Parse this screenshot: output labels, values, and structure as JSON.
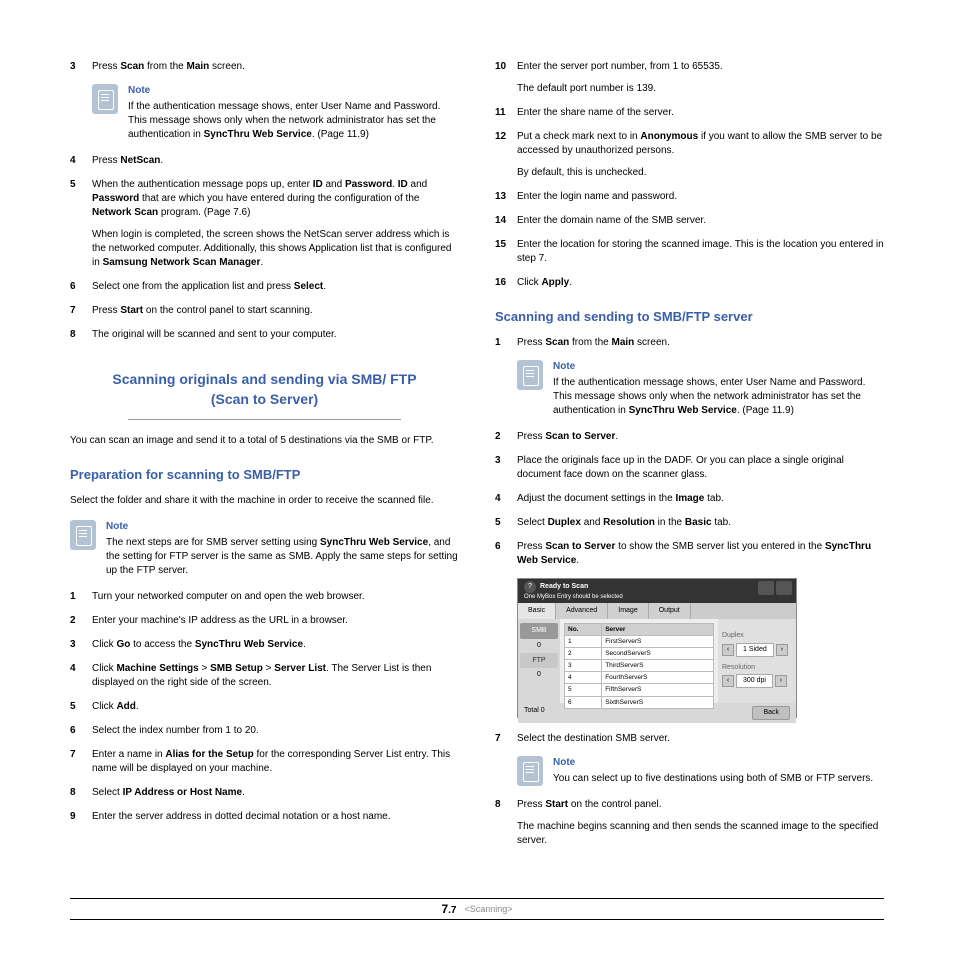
{
  "left": {
    "s3": {
      "pre": "Press ",
      "b1": "Scan",
      "mid": " from the ",
      "b2": "Main",
      "post": " screen."
    },
    "note1": {
      "title": "Note",
      "l1_pre": " If the authentication message shows, enter User Name and Password. This message shows only when the network administrator has set the authentication in ",
      "l1_b": "SyncThru Web Service",
      "l1_post": ". (Page 11.9)"
    },
    "s4": {
      "pre": "Press ",
      "b": "NetScan",
      "post": "."
    },
    "s5": {
      "p1_a": "When the authentication message pops up, enter ",
      "p1_b1": "ID",
      "p1_b": " and ",
      "p1_b2": "Password",
      "p1_c": ". ",
      "p1_b3": "ID",
      "p1_d": " and ",
      "p1_b4": "Password",
      "p1_e": " that are which you have entered during the configuration of the ",
      "p1_b5": "Network Scan",
      "p1_f": " program. (Page 7.6)",
      "p2_a": "When login is completed, the screen shows the NetScan server address which is the networked computer. Additionally, this shows Application list that is configured in ",
      "p2_b": "Samsung Network Scan Manager",
      "p2_c": "."
    },
    "s6": {
      "pre": "Select one from the application list and press ",
      "b": "Select",
      "post": "."
    },
    "s7": {
      "pre": "Press ",
      "b": "Start",
      "post": " on the control panel to start scanning."
    },
    "s8": "The original will be scanned and sent to your computer.",
    "h1_l1": "Scanning originals and sending via SMB/ FTP",
    "h1_l2": "(Scan to Server)",
    "intro1": "You can scan an image and send it to a total of 5 destinations via the SMB or FTP.",
    "h2": "Preparation for scanning to SMB/FTP",
    "intro2": "Select the folder and share it with the machine in order to receive the scanned file.",
    "note2": {
      "title": "Note",
      "a": "The next steps are for SMB server setting using ",
      "b": "SyncThru Web Service",
      "c": ", and the setting for FTP server is the same as SMB. Apply the same steps for setting up the FTP server."
    },
    "p1": "Turn your networked computer on and open the web browser.",
    "p2": "Enter your machine's IP address as the URL in a browser.",
    "p3": {
      "a": "Click ",
      "b1": "Go",
      "c": " to access the ",
      "b2": "SyncThru Web Service",
      "d": "."
    },
    "p4": {
      "a": "Click ",
      "b1": "Machine Settings",
      "gt1": " > ",
      "b2": "SMB Setup",
      "gt2": " > ",
      "b3": "Server List",
      "c": ". The Server List is then displayed on the right side of the screen."
    },
    "p5": {
      "a": "Click ",
      "b": "Add",
      "c": "."
    },
    "p6": "Select the index number from 1 to 20.",
    "p7": {
      "a": "Enter a name in ",
      "b": "Alias for the Setup",
      "c": " for the corresponding Server List entry. This name will be displayed on your machine."
    },
    "p8": {
      "a": "Select ",
      "b": "IP Address or Host Name",
      "c": "."
    },
    "p9": "Enter the server address in dotted decimal notation or a host name."
  },
  "right": {
    "s10": {
      "p1": "Enter the server port number, from 1 to 65535.",
      "p2": "The default port number is 139."
    },
    "s11": "Enter the share name of the server.",
    "s12": {
      "a": "Put a check mark next to in ",
      "b": "Anonymous",
      "c": " if you want to allow the SMB server to be accessed by unauthorized persons.",
      "p2": "By default, this is unchecked."
    },
    "s13": "Enter the login name and password.",
    "s14": "Enter the domain name of the SMB server.",
    "s15": "Enter the location for storing the scanned image. This is the location you entered in step 7.",
    "s16": {
      "a": "Click ",
      "b": "Apply",
      "c": "."
    },
    "h2": "Scanning and sending to SMB/FTP server",
    "r1": {
      "a": "Press ",
      "b1": "Scan",
      "c": " from the ",
      "b2": "Main",
      "d": " screen."
    },
    "note3": {
      "title": "Note",
      "a": " If the authentication message shows, enter User Name and Password. This message shows only when the network administrator has set the authentication in ",
      "b": "SyncThru Web Service",
      "c": ". (Page 11.9)"
    },
    "r2": {
      "a": "Press ",
      "b": "Scan to Server",
      "c": "."
    },
    "r3": "Place the originals face up in the DADF. Or you can place a single original document face down on the scanner glass.",
    "r4": {
      "a": "Adjust the document settings in the ",
      "b": "Image",
      "c": " tab."
    },
    "r5": {
      "a": "Select ",
      "b1": "Duplex",
      "c": " and ",
      "b2": "Resolution",
      "d": " in the ",
      "b3": "Basic",
      "e": " tab."
    },
    "r6": {
      "a": "Press ",
      "b1": "Scan to Server",
      "c": " to show the SMB server list you entered in the ",
      "b2": "SyncThru Web Service",
      "d": "."
    },
    "r7": "Select the destination SMB server.",
    "note4": {
      "title": "Note",
      "text": "You can select up to five destinations using both of SMB or FTP servers."
    },
    "r8": {
      "a": "Press ",
      "b": "Start",
      "c": " on the control panel.",
      "p2": "The machine begins scanning and then sends the scanned image to the specified server."
    }
  },
  "shot": {
    "ready": "Ready to Scan",
    "sub": "One MyBox Entry should be selected",
    "tabs": [
      "Basic",
      "Advanced",
      "Image",
      "Output"
    ],
    "smb": "SMB",
    "ftp": "FTP",
    "hno": "No.",
    "hserver": "Server",
    "rows": [
      [
        "1",
        "FirstServerS"
      ],
      [
        "2",
        "SecondServerS"
      ],
      [
        "3",
        "ThirdServerS"
      ],
      [
        "4",
        "FourthServerS"
      ],
      [
        "5",
        "FifthServerS"
      ],
      [
        "6",
        "SixthServerS"
      ]
    ],
    "duplex": "Duplex",
    "resolution": "Resolution",
    "dpi": "300 dpi",
    "total": "Total 0",
    "back": "Back"
  },
  "footer": {
    "num_big": "7",
    "num_small": ".7",
    "chapter": "<Scanning>"
  }
}
